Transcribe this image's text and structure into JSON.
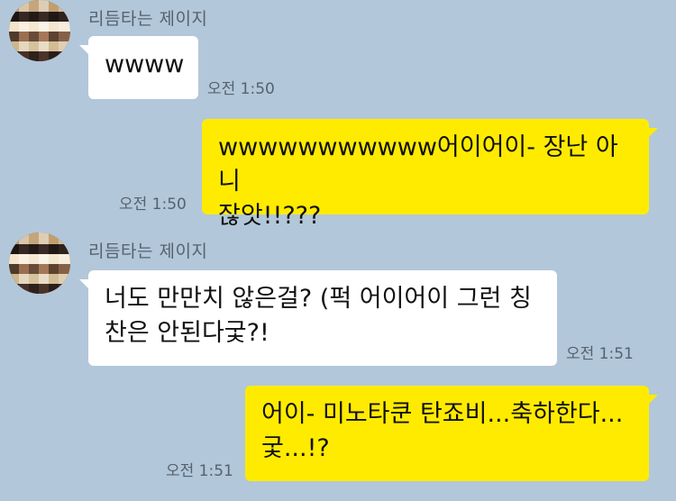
{
  "messages": [
    {
      "direction": "incoming",
      "sender": "리듬타는 제이지",
      "text": "wwww",
      "time": "오전 1:50"
    },
    {
      "direction": "outgoing",
      "text_line1": "wwwwwwwwwww어이어이- 장난 아니",
      "text_line2": "잖앗!!???",
      "time": "오전 1:50"
    },
    {
      "direction": "incoming",
      "sender": "리듬타는 제이지",
      "text_line1": "너도 만만치 않은걸? (퍽 어이어이 그런 칭",
      "text_line2": "찬은 안된다궃?!",
      "time": "오전 1:51"
    },
    {
      "direction": "outgoing",
      "text_line1": "어이- 미노타쿤 탄죠비...축하한다...",
      "text_line2": "궃...!?",
      "time": "오전 1:51"
    }
  ],
  "colors": {
    "chat_background": "#b2c7d9",
    "outgoing_bubble": "#ffeb00",
    "incoming_bubble": "#ffffff",
    "meta_text": "#556270"
  }
}
